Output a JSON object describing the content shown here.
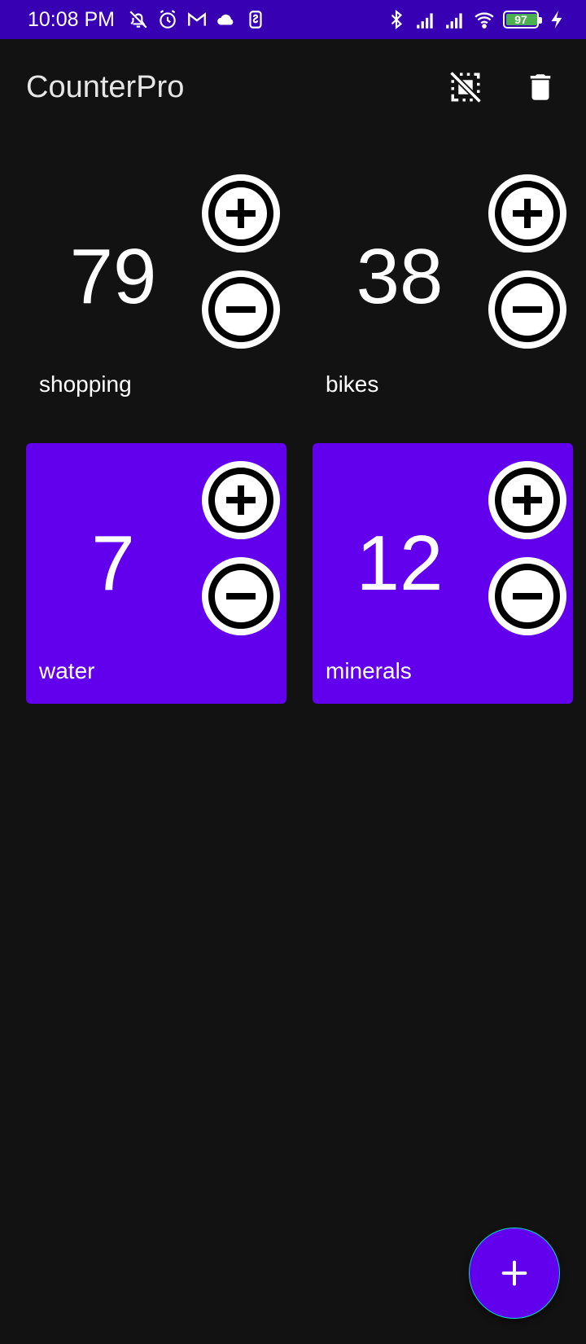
{
  "status_bar": {
    "time": "10:08 PM",
    "left_icons": [
      "bell-off-icon",
      "alarm-icon",
      "gmail-icon",
      "cloud-icon",
      "sim-icon"
    ],
    "right_icons": [
      "bluetooth-icon",
      "signal-icon",
      "signal-icon",
      "wifi-icon"
    ],
    "battery": {
      "percent_text": "97",
      "level": 0.97,
      "charging": true
    }
  },
  "app_bar": {
    "title": "CounterPro",
    "actions": [
      "deselect-all-icon",
      "delete-icon"
    ]
  },
  "counters": [
    {
      "label": "shopping",
      "count": "79",
      "selected": false
    },
    {
      "label": "bikes",
      "count": "38",
      "selected": false
    },
    {
      "label": "water",
      "count": "7",
      "selected": true
    },
    {
      "label": "minerals",
      "count": "12",
      "selected": true
    }
  ],
  "fab": {
    "icon": "plus-icon"
  },
  "colors": {
    "status_bar": "#3700b3",
    "background": "#121212",
    "primary": "#6200ee",
    "fab_outline": "#03dac5",
    "text": "#ffffff"
  }
}
